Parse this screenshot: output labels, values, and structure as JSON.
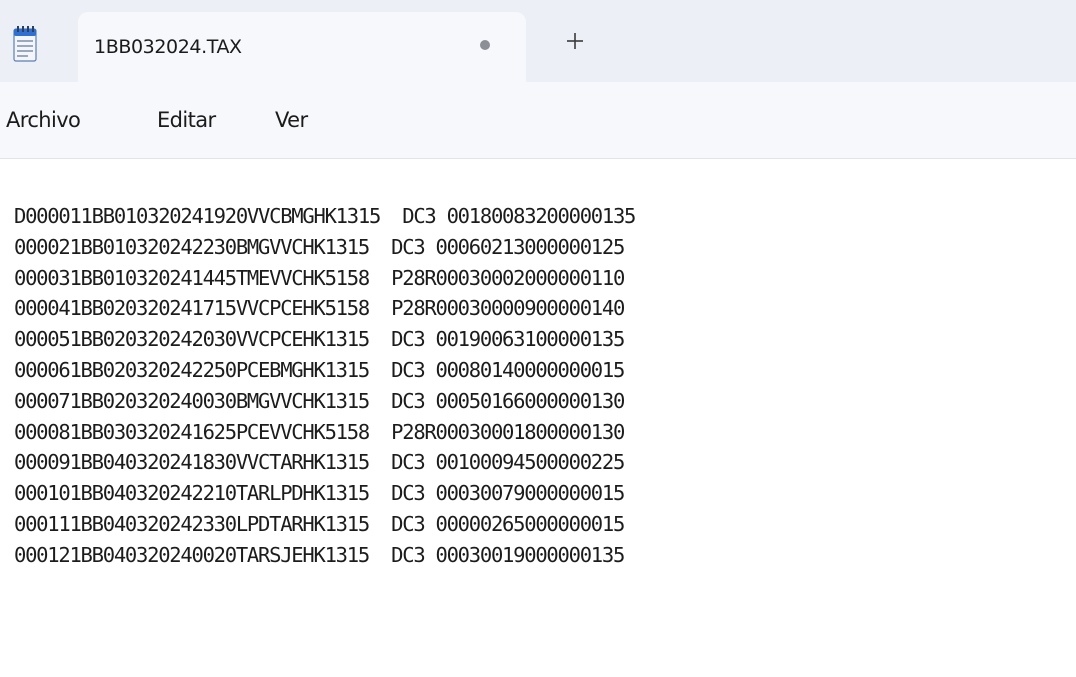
{
  "tab": {
    "title": "1BB032024.TAX",
    "icon": "notepad-icon",
    "unsaved_indicator": "●",
    "new_tab_icon": "plus-icon"
  },
  "menu": {
    "items": [
      "Archivo",
      "Editar",
      "Ver"
    ]
  },
  "content": {
    "lines": [
      "D000011BB010320241920VVCBMGHK1315  DC3 00180083200000135",
      "000021BB010320242230BMGVVCHK1315  DC3 00060213000000125",
      "000031BB010320241445TMEVVCHK5158  P28R00030002000000110",
      "000041BB020320241715VVCPCEHK5158  P28R00030000900000140",
      "000051BB020320242030VVCPCEHK1315  DC3 00190063100000135",
      "000061BB020320242250PCEBMGHK1315  DC3 00080140000000015",
      "000071BB020320240030BMGVVCHK1315  DC3 00050166000000130",
      "000081BB030320241625PCEVVCHK5158  P28R00030001800000130",
      "000091BB040320241830VVCTARHK1315  DC3 00100094500000225",
      "000101BB040320242210TARLPDHK1315  DC3 00030079000000015",
      "000111BB040320242330LPDTARHK1315  DC3 00000265000000015",
      "000121BB040320240020TARSJEHK1315  DC3 00030019000000135"
    ]
  },
  "colors": {
    "titlebar_bg": "#eceff6",
    "tab_bg": "#f7f8fc",
    "editor_bg": "#ffffff",
    "text": "#1c1c1c",
    "icon_accent": "#2f6fd1"
  }
}
